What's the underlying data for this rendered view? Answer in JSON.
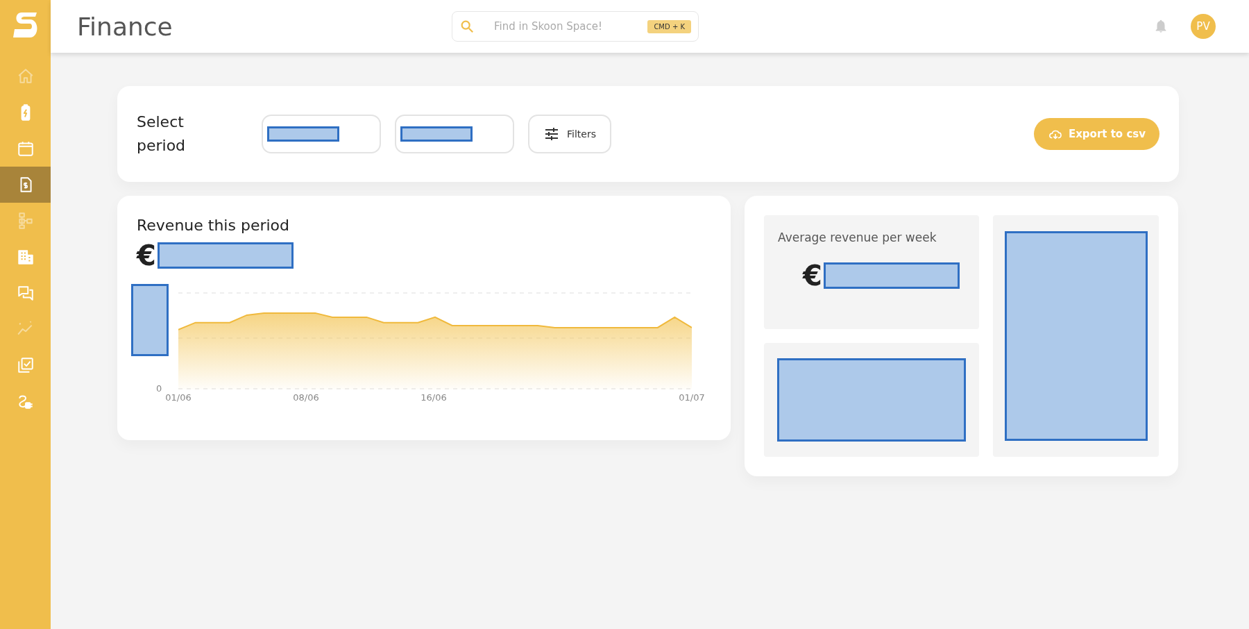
{
  "sidebar": {
    "items": [
      {
        "kind": "home",
        "selected": false,
        "disabled": true
      },
      {
        "kind": "battery",
        "selected": false,
        "disabled": false
      },
      {
        "kind": "calendar",
        "selected": false,
        "disabled": false
      },
      {
        "kind": "invoice",
        "selected": true,
        "disabled": false
      },
      {
        "kind": "hierarchy",
        "selected": false,
        "disabled": true
      },
      {
        "kind": "building",
        "selected": false,
        "disabled": false
      },
      {
        "kind": "chat",
        "selected": false,
        "disabled": false
      },
      {
        "kind": "trend",
        "selected": false,
        "disabled": true
      },
      {
        "kind": "checklist",
        "selected": false,
        "disabled": false
      },
      {
        "kind": "plug",
        "selected": false,
        "disabled": false
      }
    ]
  },
  "header": {
    "title": "Finance",
    "search": {
      "placeholder": "Find in Skoon Space!",
      "shortcut": "CMD + K"
    },
    "avatar": "PV"
  },
  "period": {
    "label": "Select period",
    "date_from": {
      "redacted": true
    },
    "date_to": {
      "redacted": true
    },
    "filters": "Filters",
    "export": "Export to csv"
  },
  "revenue": {
    "title": "Revenue this period",
    "currency": "€",
    "amount_redacted": true,
    "axis_redacted": true,
    "y_zero": "0",
    "x_labels": [
      "01/06",
      "08/06",
      "16/06",
      "01/07"
    ]
  },
  "stats": {
    "average": {
      "title": "Average revenue per week",
      "currency": "€",
      "amount_redacted": true
    },
    "second_redacted": true,
    "third_redacted": true
  }
}
